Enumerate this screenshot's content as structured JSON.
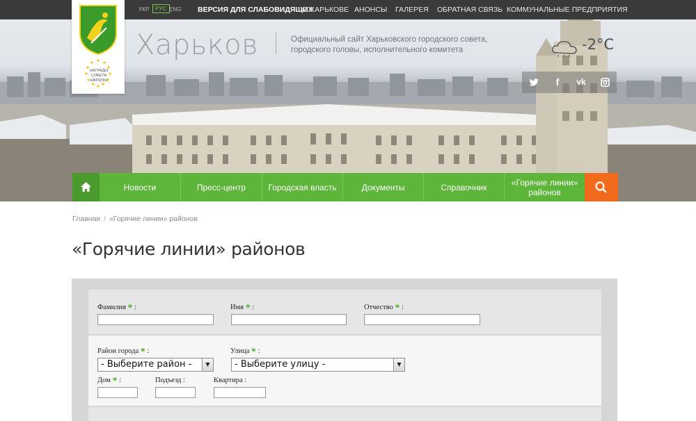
{
  "top_bar": {
    "languages": [
      "УКР",
      "РУС",
      "ENG"
    ],
    "active_language": "РУС",
    "links": [
      "ВЕРСИЯ ДЛЯ СЛАБОВИДЯЩИХ",
      "О ХАРЬКОВЕ",
      "АНОНСЫ",
      "ГАЛЕРЕЯ",
      "ОБРАТНАЯ СВЯЗЬ",
      "КОММУНАЛЬНЫЕ ПРЕДПРИЯТИЯ"
    ]
  },
  "header": {
    "logo_award_text": "НАГРАДЫ СОВЕТА ЕВРОПЫ",
    "city": "Харьков",
    "subtitle_line1": "Официальный сайт Харьковского городского совета,",
    "subtitle_line2": "городского головы, исполнительного комитета",
    "temperature": "-2°C",
    "weather_icon": "cloud-snow-icon",
    "social": [
      "twitter-icon",
      "facebook-icon",
      "vk-icon",
      "instagram-icon"
    ]
  },
  "main_nav": {
    "items": [
      "Новости",
      "Пресс-центр",
      "Городская власть",
      "Документы",
      "Справочник",
      "«Горячие линии»",
      "районов"
    ]
  },
  "breadcrumb": {
    "home": "Главная",
    "separator": "/",
    "current": "«Горячие линии» районов"
  },
  "page_title": "«Горячие линии» районов",
  "form": {
    "surname_label": "Фамилия",
    "name_label": "Имя",
    "patronymic_label": "Отчество",
    "district_label": "Район города",
    "street_label": "Улица",
    "house_label": "Дом",
    "entrance_label": "Подъезд :",
    "apartment_label": "Квартира :",
    "required_mark": "*",
    "colon": ":",
    "district_value": "- Выберите район -",
    "street_value": "- Выберите улицу -"
  },
  "colors": {
    "nav_green": "#5db53a",
    "nav_home": "#4a9a2e",
    "search_orange": "#f26a1b",
    "required_green": "#4cae2c"
  }
}
